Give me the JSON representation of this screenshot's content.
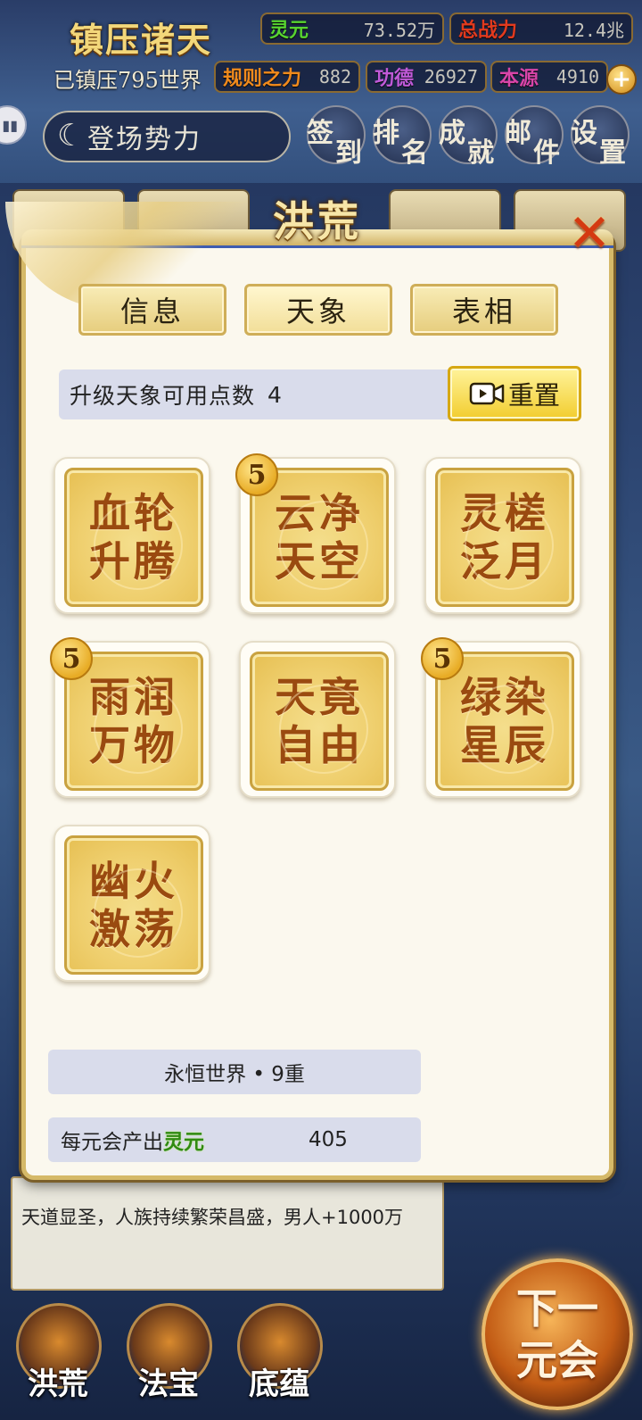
{
  "hud": {
    "title": "镇压诸天",
    "suppressed_worlds": "已镇压795世界",
    "resources": [
      {
        "label": "灵元",
        "value": "73.52万",
        "color": "#58d430"
      },
      {
        "label": "总战力",
        "value": "12.4兆",
        "color": "#e23a1e"
      },
      {
        "label": "规则之力",
        "value": "882",
        "color": "#f08a1c"
      },
      {
        "label": "功德",
        "value": "26927",
        "color": "#c05ad8"
      },
      {
        "label": "本源",
        "value": "4910",
        "color": "#d845a8"
      }
    ],
    "plus_icon": "plus-icon",
    "appear_label": "登场势力",
    "nav": [
      {
        "c1": "签",
        "c2": "到"
      },
      {
        "c1": "排",
        "c2": "名"
      },
      {
        "c1": "成",
        "c2": "就"
      },
      {
        "c1": "邮",
        "c2": "件"
      },
      {
        "c1": "设",
        "c2": "置"
      }
    ]
  },
  "dialog": {
    "title": "洪荒",
    "close_icon": "close-icon",
    "tabs": [
      "信息",
      "天象",
      "表相"
    ],
    "active_tab": 1,
    "points_label": "升级天象可用点数",
    "points_value": "4",
    "reset_label": "重置",
    "reset_icon": "video-camera-icon",
    "phenomena": [
      {
        "l1": "血轮",
        "l2": "升腾",
        "level": ""
      },
      {
        "l1": "云净",
        "l2": "天空",
        "level": "5"
      },
      {
        "l1": "灵槎",
        "l2": "泛月",
        "level": ""
      },
      {
        "l1": "雨润",
        "l2": "万物",
        "level": "5"
      },
      {
        "l1": "天竟",
        "l2": "自由",
        "level": ""
      },
      {
        "l1": "绿染",
        "l2": "星辰",
        "level": "5"
      },
      {
        "l1": "幽火",
        "l2": "激荡",
        "level": ""
      }
    ],
    "world_tier": "永恒世界 • 9重",
    "output_prefix": "每元会产出",
    "output_resource": "灵元",
    "output_value": "405"
  },
  "log": {
    "text": "天道显圣，人族持续繁荣昌盛，男人+1000万"
  },
  "bottom_tabs": [
    "洪荒",
    "法宝",
    "底蕴"
  ],
  "next_button": {
    "l1": "下一",
    "l2": "元会"
  }
}
